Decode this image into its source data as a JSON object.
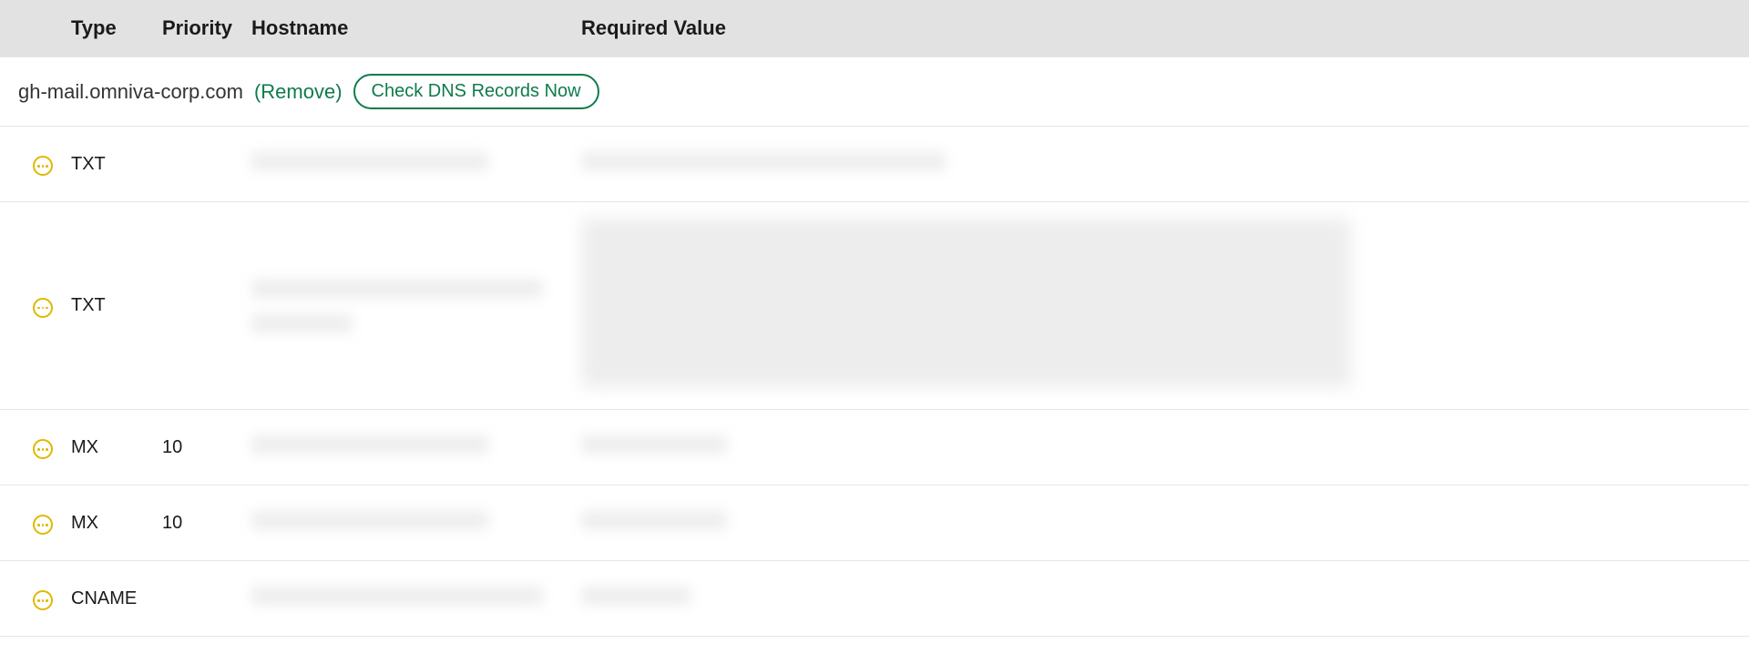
{
  "columns": {
    "type": "Type",
    "priority": "Priority",
    "hostname": "Hostname",
    "value": "Required Value"
  },
  "domain": {
    "name": "gh-mail.omniva-corp.com",
    "remove_label": "(Remove)",
    "check_label": "Check DNS Records Now"
  },
  "records": [
    {
      "type": "TXT",
      "priority": "",
      "hostname_blur": "short",
      "value_blur": "val1",
      "tall": false
    },
    {
      "type": "TXT",
      "priority": "",
      "hostname_blur": "med2",
      "value_blur": "block",
      "tall": true
    },
    {
      "type": "MX",
      "priority": "10",
      "hostname_blur": "short",
      "value_blur": "s",
      "tall": false
    },
    {
      "type": "MX",
      "priority": "10",
      "hostname_blur": "short",
      "value_blur": "s",
      "tall": false
    },
    {
      "type": "CNAME",
      "priority": "",
      "hostname_blur": "med",
      "value_blur": "xs",
      "tall": false
    }
  ]
}
